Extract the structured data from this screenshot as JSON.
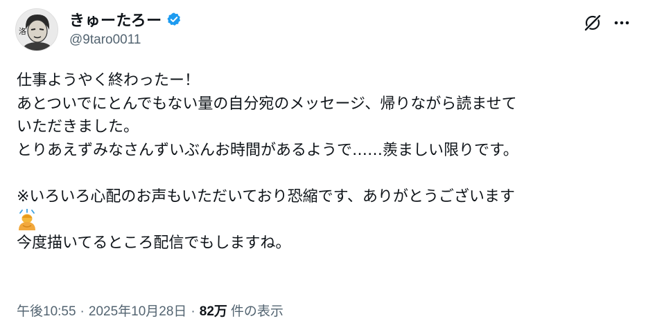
{
  "author": {
    "display_name": "きゅーたろー",
    "handle": "@9taro0011",
    "verified": true
  },
  "tweet": {
    "lines": [
      "仕事ようやく終わったー！",
      "あとついでにとんでもない量の自分宛のメッセージ、帰りながら読ませて",
      "いただきました。",
      "とりあえずみなさんずいぶんお時間があるようで……羨ましい限りです。",
      "",
      "※いろいろ心配のお声もいただいており恐縮です、ありがとうございます",
      "今度描いてるところ配信でもしますね。"
    ],
    "emoji": "person-bowing-emoji"
  },
  "meta": {
    "time": "午後10:55",
    "separator": "·",
    "date": "2025年10月28日",
    "views_count": "82万",
    "views_label": "件の表示"
  },
  "icons": {
    "verified": "verified-badge-icon",
    "grok": "grok-icon",
    "more": "more-options-icon"
  },
  "colors": {
    "text": "#0f1419",
    "secondary": "#536471",
    "verified_blue": "#1d9bf0"
  }
}
